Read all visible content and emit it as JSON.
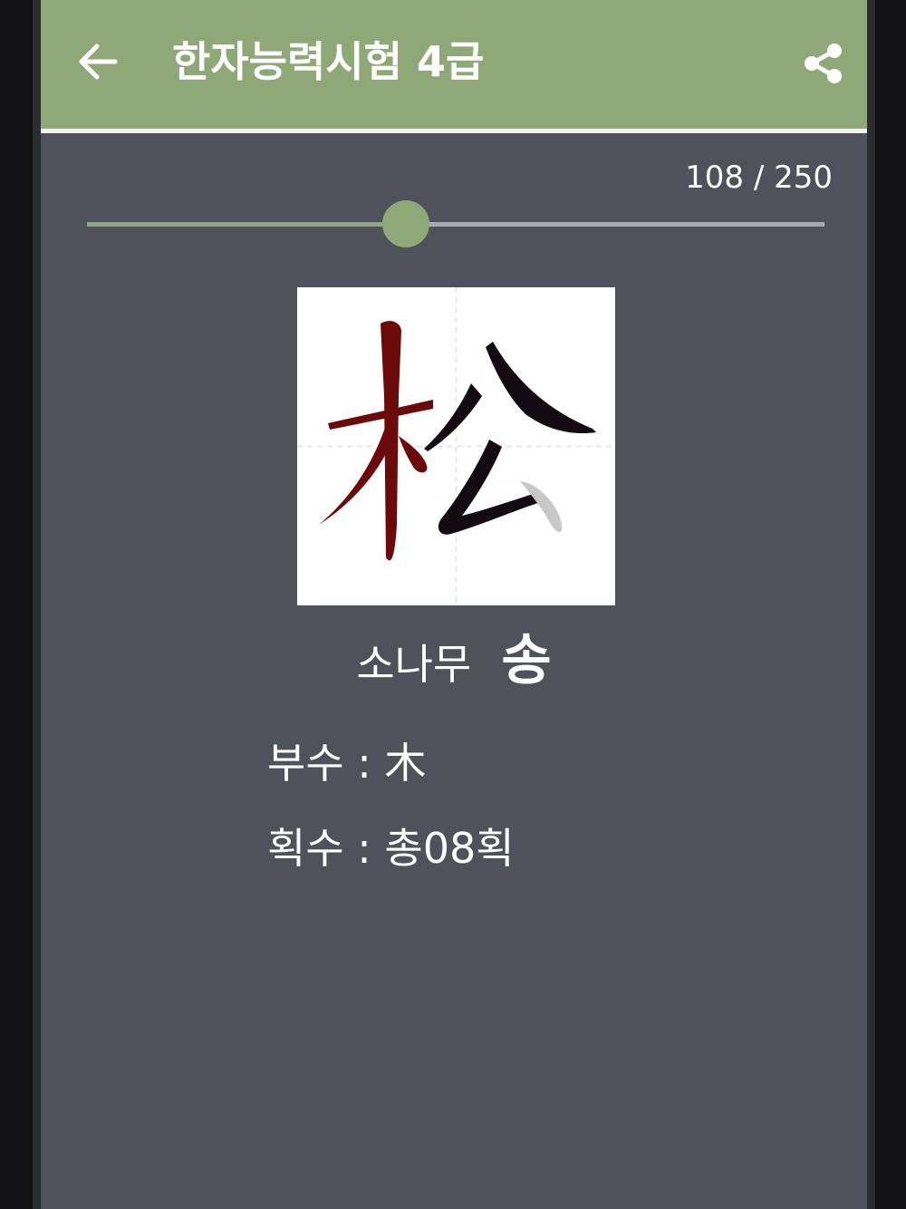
{
  "app_bar": {
    "title": "한자능력시험 4급",
    "back_icon": "arrow-left-icon",
    "share_icon": "share-icon",
    "color": "#8fa878"
  },
  "progress": {
    "current": 108,
    "total": 250,
    "label": "108 / 250",
    "fraction": 0.432
  },
  "character": {
    "hanja": "松",
    "meaning": "소나무",
    "reading": "송",
    "radical_label": "부수",
    "radical": "木",
    "radical_line": "부수 : 木",
    "strokes_label": "획수",
    "strokes_value": "총08획",
    "strokes_line": "획수 : 총08획",
    "completed_stroke_color": "#6b0a0a",
    "current_stroke_color": "#140b12",
    "next_stroke_color": "#c8c8c8"
  },
  "colors": {
    "background": "#4f525a",
    "accent": "#8fa878"
  }
}
